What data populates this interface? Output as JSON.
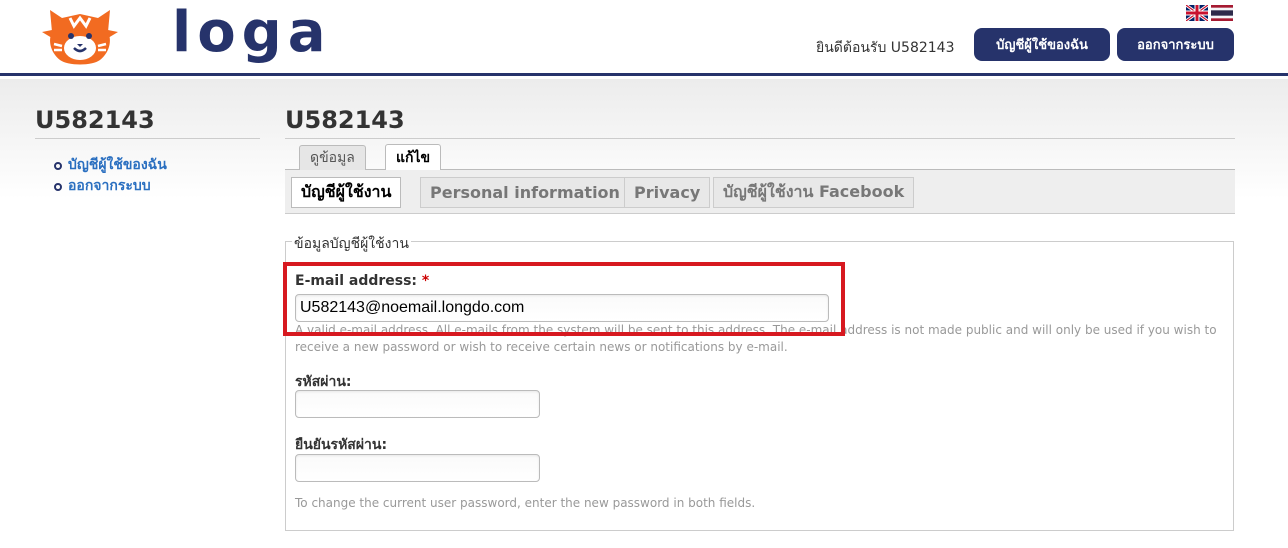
{
  "header": {
    "logo_text": "loga",
    "welcome": "ยินดีต้อนรับ U582143",
    "my_account_button": "บัญชีผู้ใช้ของฉัน",
    "logout_button": "ออกจากระบบ",
    "flags": [
      "english-flag-icon",
      "thai-flag-icon"
    ]
  },
  "sidebar": {
    "title": "U582143",
    "items": [
      {
        "label": "บัญชีผู้ใช้ของฉัน"
      },
      {
        "label": "ออกจากระบบ"
      }
    ]
  },
  "main": {
    "title": "U582143",
    "tabs": [
      {
        "label": "ดูข้อมูล"
      },
      {
        "label": "แก้ไข",
        "active": true
      }
    ],
    "subtabs": [
      {
        "label": "บัญชีผู้ใช้งาน",
        "active": true
      },
      {
        "label": "Personal information"
      },
      {
        "label": "Privacy"
      },
      {
        "label": "บัญชีผู้ใช้งาน Facebook"
      }
    ],
    "fieldset_legend": "ข้อมูลบัญชีผู้ใช้งาน",
    "email": {
      "label": "E-mail address:",
      "required_mark": "*",
      "value": "U582143@noemail.longdo.com",
      "description_line1": "A valid e-mail address. All e-mails from the system will be sent to this address. The e-mail address is not made public and will only be used if you wish to",
      "description_line2": "receive a new password or wish to receive certain news or notifications by e-mail."
    },
    "password": {
      "label": "รหัสผ่าน:",
      "value": ""
    },
    "confirm_password": {
      "label": "ยืนยันรหัสผ่าน:",
      "value": ""
    },
    "password_hint": "To change the current user password, enter the new password in both fields."
  },
  "colors": {
    "brand_navy": "#26336b",
    "logo_orange": "#f26b21",
    "link_blue": "#2a6fc0",
    "highlight_red": "#d71920"
  }
}
